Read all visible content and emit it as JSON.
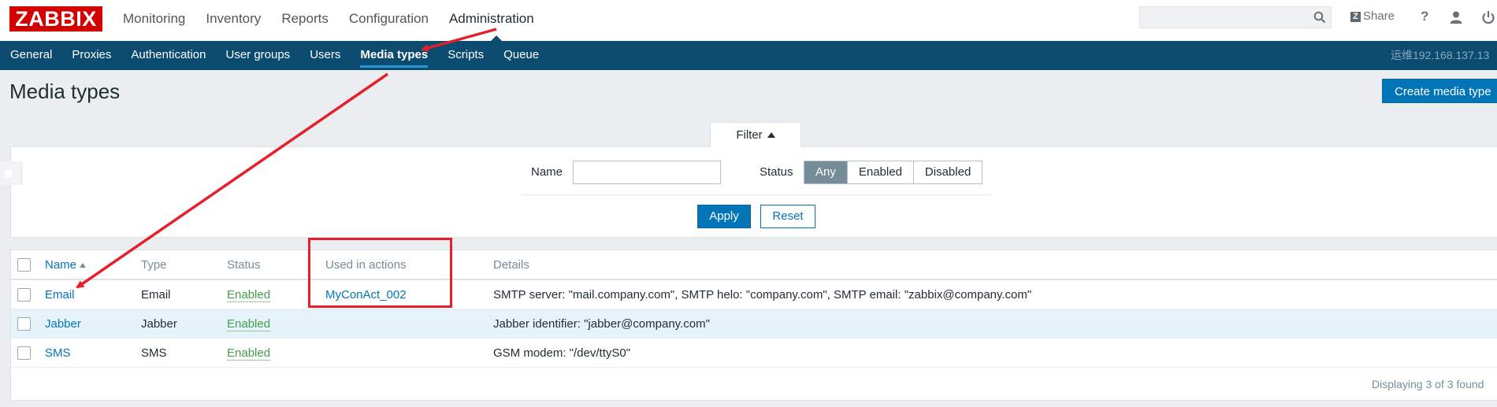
{
  "header": {
    "logo": "ZABBIX",
    "menu": [
      "Monitoring",
      "Inventory",
      "Reports",
      "Configuration",
      "Administration"
    ],
    "active_menu": "Administration",
    "search": {
      "placeholder": "",
      "value": ""
    },
    "share_label": "Share",
    "help_label": "?"
  },
  "subnav": {
    "items": [
      "General",
      "Proxies",
      "Authentication",
      "User groups",
      "Users",
      "Media types",
      "Scripts",
      "Queue"
    ],
    "active": "Media types",
    "server_name": "运维192.168.137.13"
  },
  "page": {
    "title": "Media types",
    "create_button": "Create media type"
  },
  "filter": {
    "tab_label": "Filter",
    "name_label": "Name",
    "name_value": "",
    "status_label": "Status",
    "status_options": [
      "Any",
      "Enabled",
      "Disabled"
    ],
    "status_selected": "Any",
    "apply_label": "Apply",
    "reset_label": "Reset"
  },
  "table": {
    "columns": [
      "Name",
      "Type",
      "Status",
      "Used in actions",
      "Details"
    ],
    "sorted_column": "Name",
    "rows": [
      {
        "name": "Email",
        "type": "Email",
        "status": "Enabled",
        "used_in_actions": "MyConAct_002",
        "details": "SMTP server: \"mail.company.com\", SMTP helo: \"company.com\", SMTP email: \"zabbix@company.com\""
      },
      {
        "name": "Jabber",
        "type": "Jabber",
        "status": "Enabled",
        "used_in_actions": "",
        "details": "Jabber identifier: \"jabber@company.com\""
      },
      {
        "name": "SMS",
        "type": "SMS",
        "status": "Enabled",
        "used_in_actions": "",
        "details": "GSM modem: \"/dev/ttyS0\""
      }
    ],
    "footer": "Displaying 3 of 3 found"
  },
  "colors": {
    "brand_red": "#d40000",
    "nav_blue": "#0b4b70",
    "primary": "#0275b8",
    "status_green": "#429e47",
    "annotation_red": "#e5202c"
  },
  "icons": [
    "search-icon",
    "share-icon",
    "help-icon",
    "user-icon",
    "power-icon",
    "sort-ascending-icon",
    "filter-collapse-icon"
  ]
}
